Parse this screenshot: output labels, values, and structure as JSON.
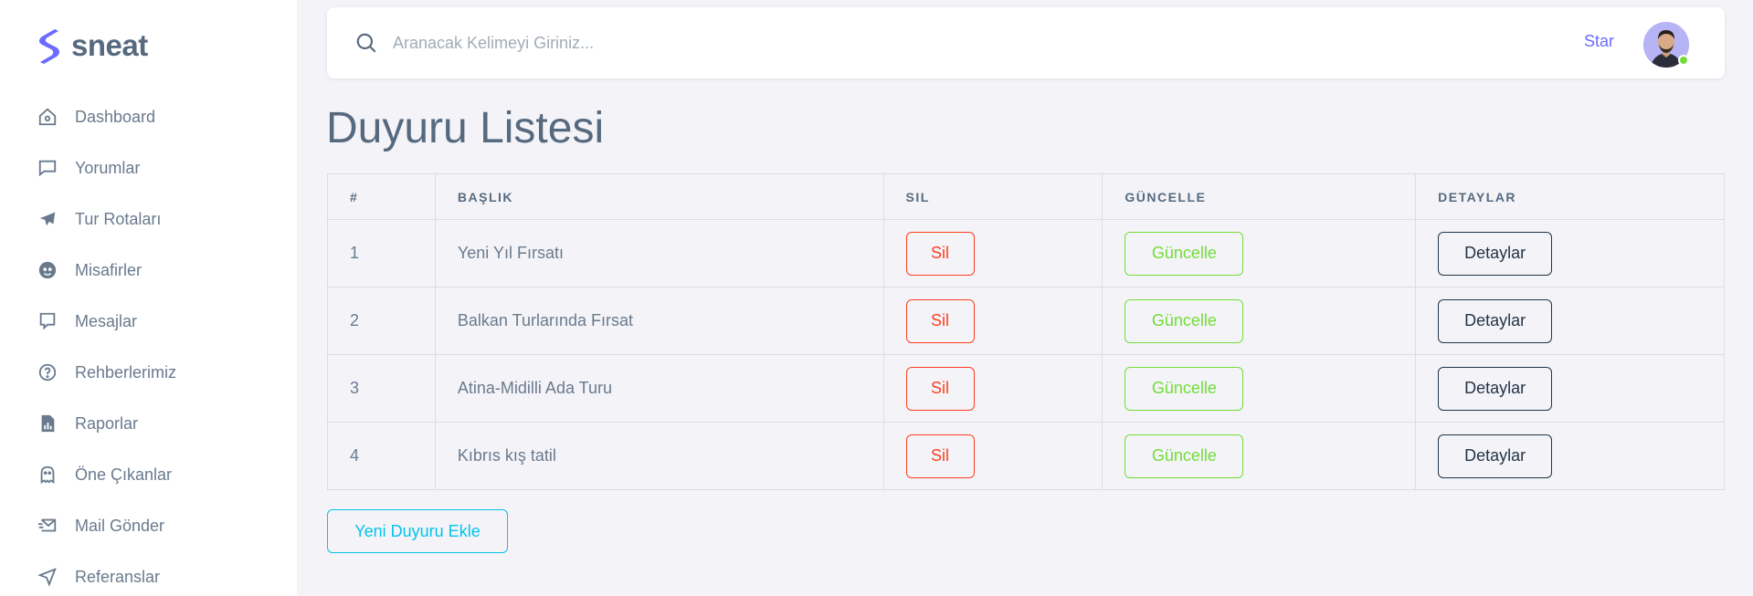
{
  "brand": {
    "name": "sneat"
  },
  "sidebar": {
    "items": [
      {
        "label": "Dashboard",
        "icon": "home-icon"
      },
      {
        "label": "Yorumlar",
        "icon": "comment-icon"
      },
      {
        "label": "Tur Rotaları",
        "icon": "plane-icon"
      },
      {
        "label": "Misafirler",
        "icon": "face-icon"
      },
      {
        "label": "Mesajlar",
        "icon": "message-icon"
      },
      {
        "label": "Rehberlerimiz",
        "icon": "help-circle-icon"
      },
      {
        "label": "Raporlar",
        "icon": "report-icon"
      },
      {
        "label": "Öne Çıkanlar",
        "icon": "ghost-icon"
      },
      {
        "label": "Mail Gönder",
        "icon": "mail-send-icon"
      },
      {
        "label": "Referanslar",
        "icon": "navigation-icon"
      }
    ]
  },
  "navbar": {
    "search_placeholder": "Aranacak Kelimeyi Giriniz...",
    "star_label": "Star"
  },
  "page": {
    "title": "Duyuru Listesi"
  },
  "table": {
    "headers": [
      "#",
      "BAŞLIK",
      "SIL",
      "GÜNCELLE",
      "DETAYLAR"
    ],
    "rows": [
      {
        "id": "1",
        "title": "Yeni Yıl Fırsatı",
        "delete": "Sil",
        "update": "Güncelle",
        "details": "Detaylar"
      },
      {
        "id": "2",
        "title": "Balkan Turlarında Fırsat",
        "delete": "Sil",
        "update": "Güncelle",
        "details": "Detaylar"
      },
      {
        "id": "3",
        "title": "Atina-Midilli Ada Turu",
        "delete": "Sil",
        "update": "Güncelle",
        "details": "Detaylar"
      },
      {
        "id": "4",
        "title": "Kıbrıs kış tatil",
        "delete": "Sil",
        "update": "Güncelle",
        "details": "Detaylar"
      }
    ]
  },
  "actions": {
    "add_label": "Yeni Duyuru Ekle"
  },
  "colors": {
    "primary": "#696cff",
    "danger": "#ff3e1d",
    "success": "#71dd37",
    "dark": "#233446",
    "info": "#03c3ec"
  }
}
